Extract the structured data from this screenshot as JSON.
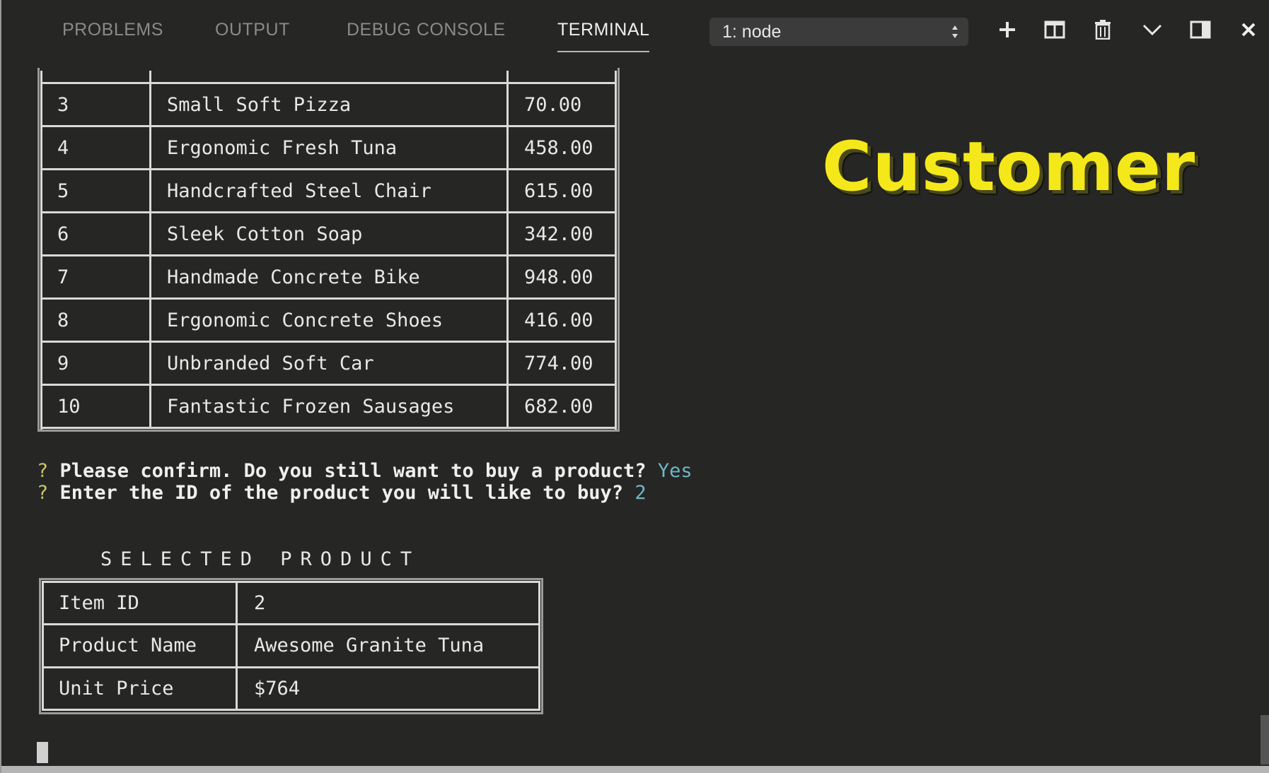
{
  "tabs": [
    {
      "label": "PROBLEMS",
      "active": false
    },
    {
      "label": "OUTPUT",
      "active": false
    },
    {
      "label": "DEBUG CONSOLE",
      "active": false
    },
    {
      "label": "TERMINAL",
      "active": true
    }
  ],
  "terminal_select": {
    "value": "1: node"
  },
  "toolbar_icons": [
    "plus-icon",
    "split-icon",
    "trash-icon",
    "chevron-down-icon",
    "maximize-panel-icon",
    "close-icon"
  ],
  "products_table": {
    "rows": [
      {
        "id": "3",
        "name": "Small Soft Pizza",
        "price": "70.00"
      },
      {
        "id": "4",
        "name": "Ergonomic Fresh Tuna",
        "price": "458.00"
      },
      {
        "id": "5",
        "name": "Handcrafted Steel Chair",
        "price": "615.00"
      },
      {
        "id": "6",
        "name": "Sleek Cotton Soap",
        "price": "342.00"
      },
      {
        "id": "7",
        "name": "Handmade Concrete Bike",
        "price": "948.00"
      },
      {
        "id": "8",
        "name": "Ergonomic Concrete Shoes",
        "price": "416.00"
      },
      {
        "id": "9",
        "name": "Unbranded Soft Car",
        "price": "774.00"
      },
      {
        "id": "10",
        "name": "Fantastic Frozen Sausages",
        "price": "682.00"
      }
    ]
  },
  "prompts": [
    {
      "marker": "?",
      "question": "Please confirm. Do you still want to buy a product?",
      "answer": "Yes"
    },
    {
      "marker": "?",
      "question": "Enter the ID of the product you will like to buy?",
      "answer": "2"
    }
  ],
  "selected_product": {
    "heading": "SELECTED PRODUCT",
    "rows": [
      {
        "label": "Item ID",
        "value": "2"
      },
      {
        "label": "Product Name",
        "value": "Awesome Granite Tuna"
      },
      {
        "label": "Unit Price",
        "value": "$764"
      }
    ]
  },
  "overlay_title": "Customer",
  "colors": {
    "background": "#262625",
    "overlay_title": "#f5e81a",
    "prompt_marker": "#c9c36a",
    "answer": "#6fb6c6"
  }
}
